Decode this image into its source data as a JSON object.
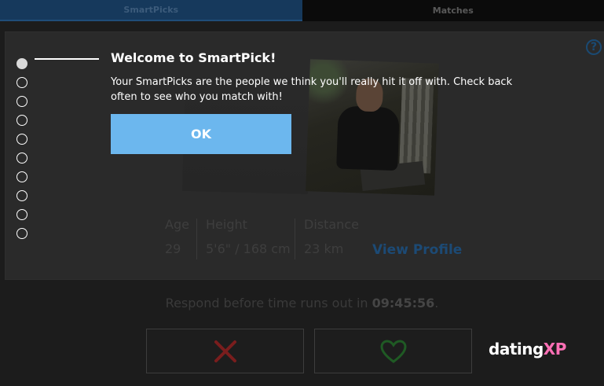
{
  "tabs": [
    {
      "label": "SmartPicks",
      "active": true
    },
    {
      "label": "Matches",
      "active": false
    }
  ],
  "help_icon": "?",
  "profile": {
    "stats": [
      {
        "label": "Age",
        "value": "29"
      },
      {
        "label": "Height",
        "value": "5'6\" / 168 cm"
      },
      {
        "label": "Distance",
        "value": "23 km"
      }
    ],
    "view_profile_label": "View Profile"
  },
  "respond": {
    "prefix": "Respond before time runs out in ",
    "timer": "09:45:56",
    "suffix": "."
  },
  "actions": {
    "reject_icon": "close-icon",
    "like_icon": "heart-icon"
  },
  "logo": {
    "text_main": "dating",
    "text_accent": "XP"
  },
  "onboarding": {
    "step_count": 10,
    "current_step": 1,
    "title": "Welcome to SmartPick!",
    "body": "Your SmartPicks are the people we think you'll really hit it off with. Check back often to see who you match with!",
    "ok_label": "OK"
  },
  "colors": {
    "ok_button": "#6cb7ee",
    "view_profile": "#1c4a75",
    "reject": "#7a1d1d",
    "like": "#1f5a24",
    "logo_accent": "#ff6fb5"
  }
}
